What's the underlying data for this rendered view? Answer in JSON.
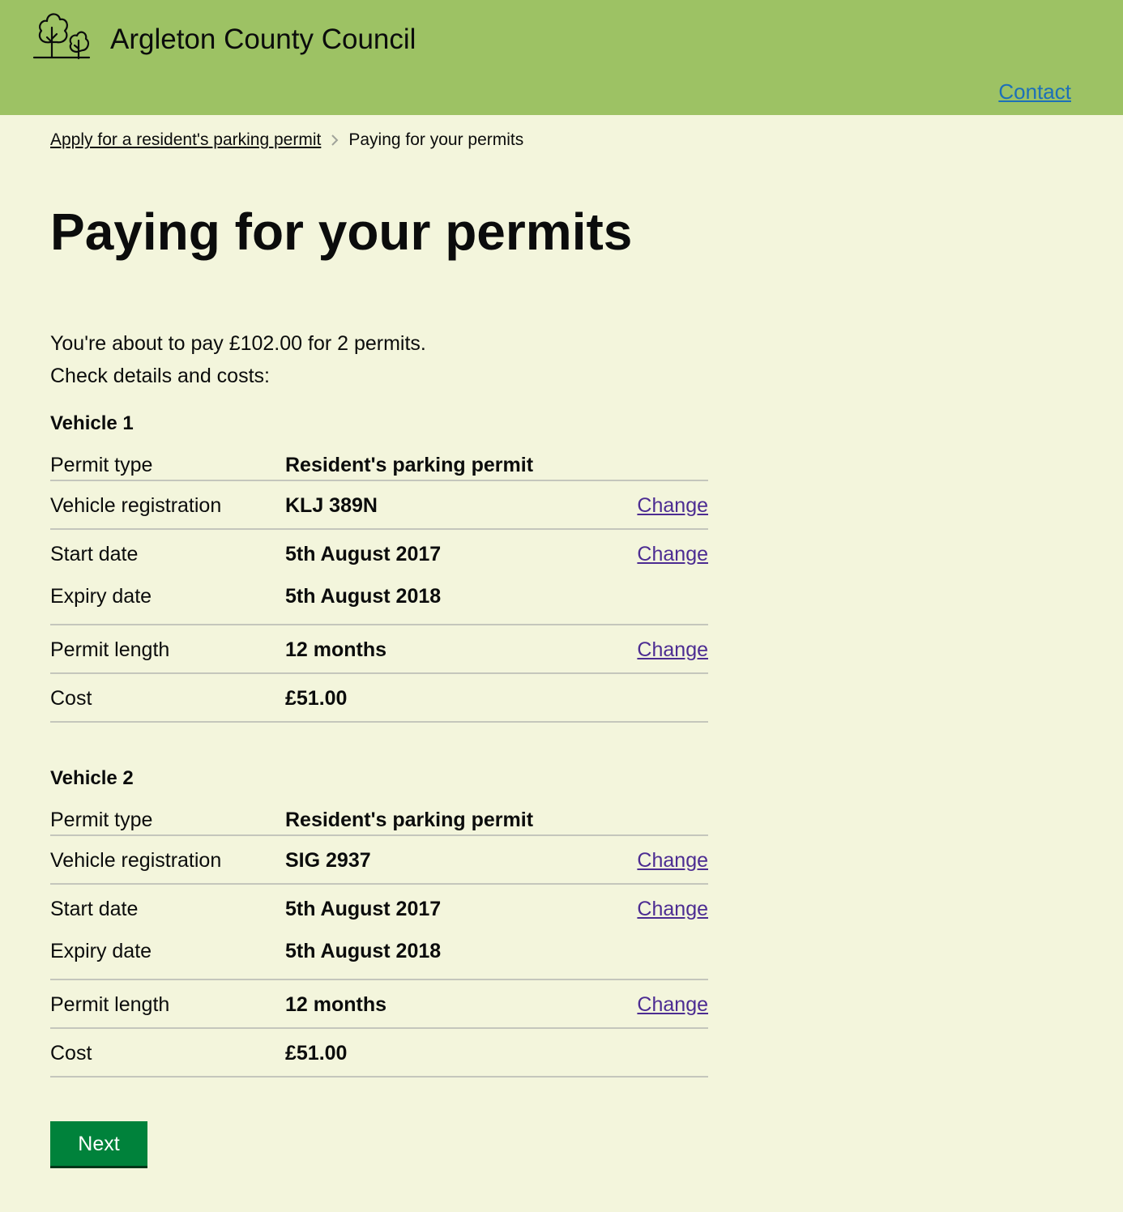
{
  "header": {
    "brand": "Argleton County Council",
    "logo_icon": "trees-icon",
    "contact_label": "Contact",
    "bg_color": "#9dc264"
  },
  "breadcrumb": {
    "parent": "Apply for a resident's parking permit",
    "current": "Paying for your permits"
  },
  "page": {
    "title": "Paying for your permits",
    "intro_line1": "You're about to pay £102.00 for 2 permits.",
    "intro_line2": "Check details and costs:"
  },
  "vehicles": [
    {
      "heading": "Vehicle 1",
      "rows": [
        {
          "key": "Permit type",
          "value": "Resident's parking permit",
          "action": ""
        },
        {
          "key": "Vehicle registration",
          "value": "KLJ 389N",
          "action": "Change"
        },
        {
          "key": "Start date",
          "value": "5th August 2017",
          "action": "Change"
        },
        {
          "key": "Expiry date",
          "value": "5th August 2018",
          "action": ""
        },
        {
          "key": "Permit length",
          "value": "12 months",
          "action": "Change"
        },
        {
          "key": "Cost",
          "value": "£51.00",
          "action": ""
        }
      ]
    },
    {
      "heading": "Vehicle 2",
      "rows": [
        {
          "key": "Permit type",
          "value": "Resident's parking permit",
          "action": ""
        },
        {
          "key": "Vehicle registration",
          "value": "SIG 2937",
          "action": "Change"
        },
        {
          "key": "Start date",
          "value": "5th August 2017",
          "action": "Change"
        },
        {
          "key": "Expiry date",
          "value": "5th August 2018",
          "action": ""
        },
        {
          "key": "Permit length",
          "value": "12 months",
          "action": "Change"
        },
        {
          "key": "Cost",
          "value": "£51.00",
          "action": ""
        }
      ]
    }
  ],
  "next_button_label": "Next"
}
